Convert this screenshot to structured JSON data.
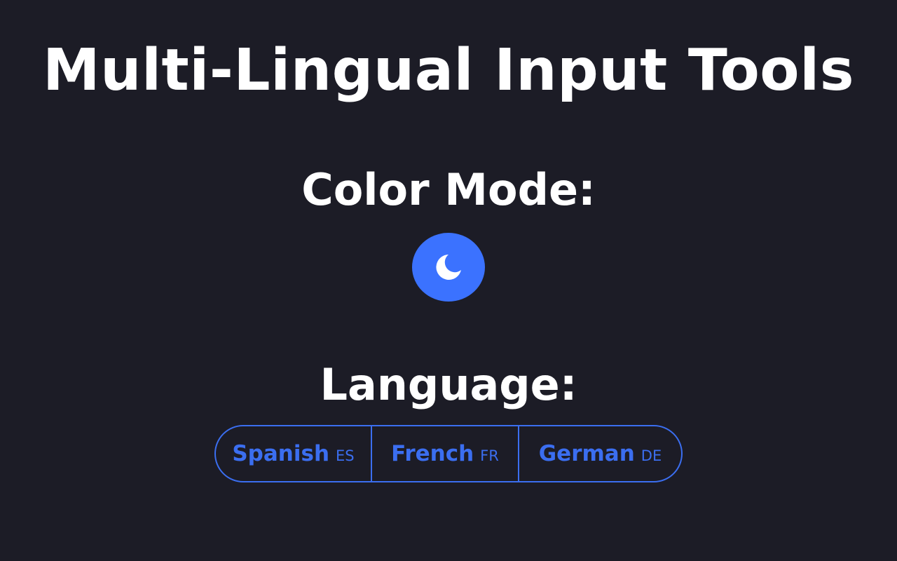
{
  "header": {
    "title": "Multi-Lingual Input Tools"
  },
  "color_mode": {
    "heading": "Color Mode:",
    "current_mode": "dark",
    "toggle_icon": "moon-icon",
    "toggle_color": "#3b72ff"
  },
  "language": {
    "heading": "Language:",
    "options": [
      {
        "name": "Spanish",
        "code": "ES"
      },
      {
        "name": "French",
        "code": "FR"
      },
      {
        "name": "German",
        "code": "DE"
      }
    ]
  },
  "colors": {
    "background": "#1c1c26",
    "text": "#ffffff",
    "accent": "#3b6ef0"
  }
}
